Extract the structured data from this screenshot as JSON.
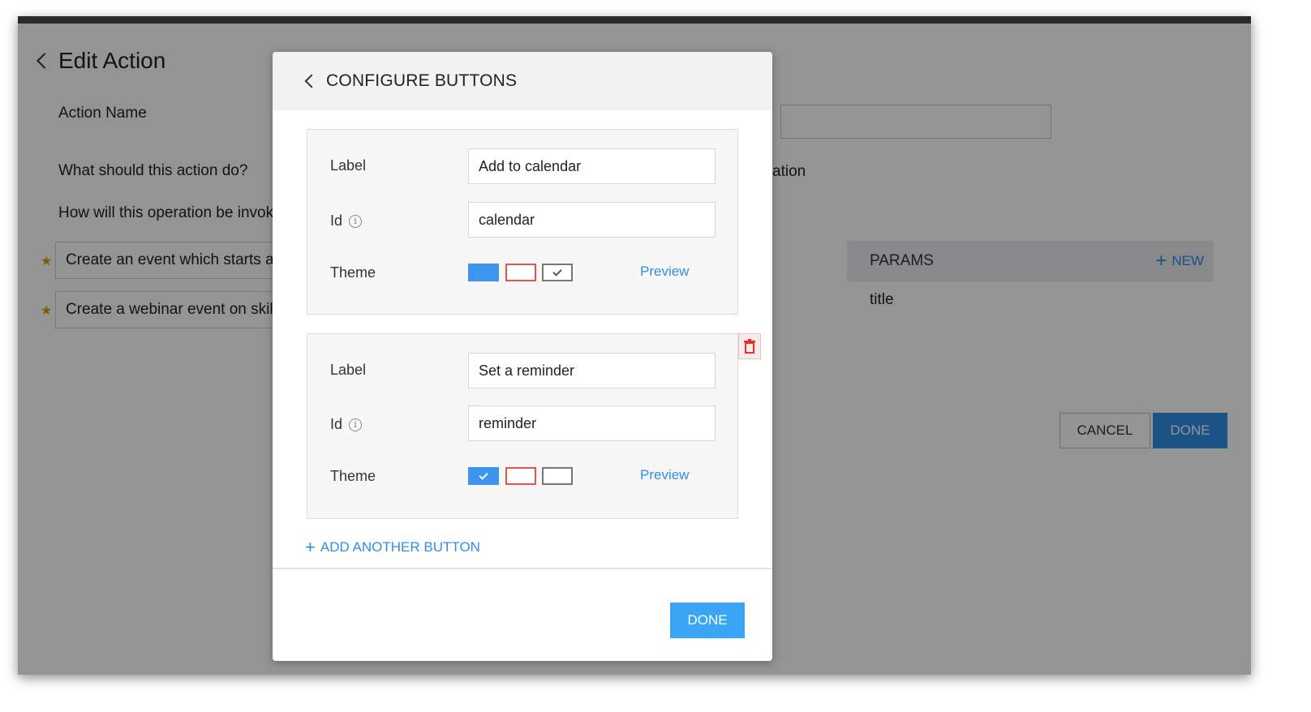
{
  "background": {
    "title": "Edit Action",
    "action_name_label": "Action Name",
    "action_question": "What should this action do?",
    "invoke_question": "How will this operation be invok",
    "action_suffix": "ation",
    "examples": [
      "Create an event which starts a",
      "Create a webinar event on skill"
    ],
    "params": {
      "title": "PARAMS",
      "new_label": "NEW",
      "items": [
        "title"
      ]
    },
    "cancel_label": "CANCEL",
    "done_label": "DONE"
  },
  "modal": {
    "title": "CONFIGURE BUTTONS",
    "buttons": [
      {
        "label_caption": "Label",
        "label_value": "Add to calendar",
        "id_caption": "Id",
        "id_value": "calendar",
        "theme_caption": "Theme",
        "selected_theme": "default",
        "preview_label": "Preview"
      },
      {
        "label_caption": "Label",
        "label_value": "Set a reminder",
        "id_caption": "Id",
        "id_value": "reminder",
        "theme_caption": "Theme",
        "selected_theme": "primary",
        "preview_label": "Preview"
      }
    ],
    "add_button_label": "ADD ANOTHER BUTTON",
    "done_label": "DONE"
  },
  "colors": {
    "accent": "#2f8fe8",
    "primary_swatch": "#3e95ef",
    "danger_swatch": "#e8524a",
    "default_swatch": "#777777",
    "star": "#d9a100"
  }
}
